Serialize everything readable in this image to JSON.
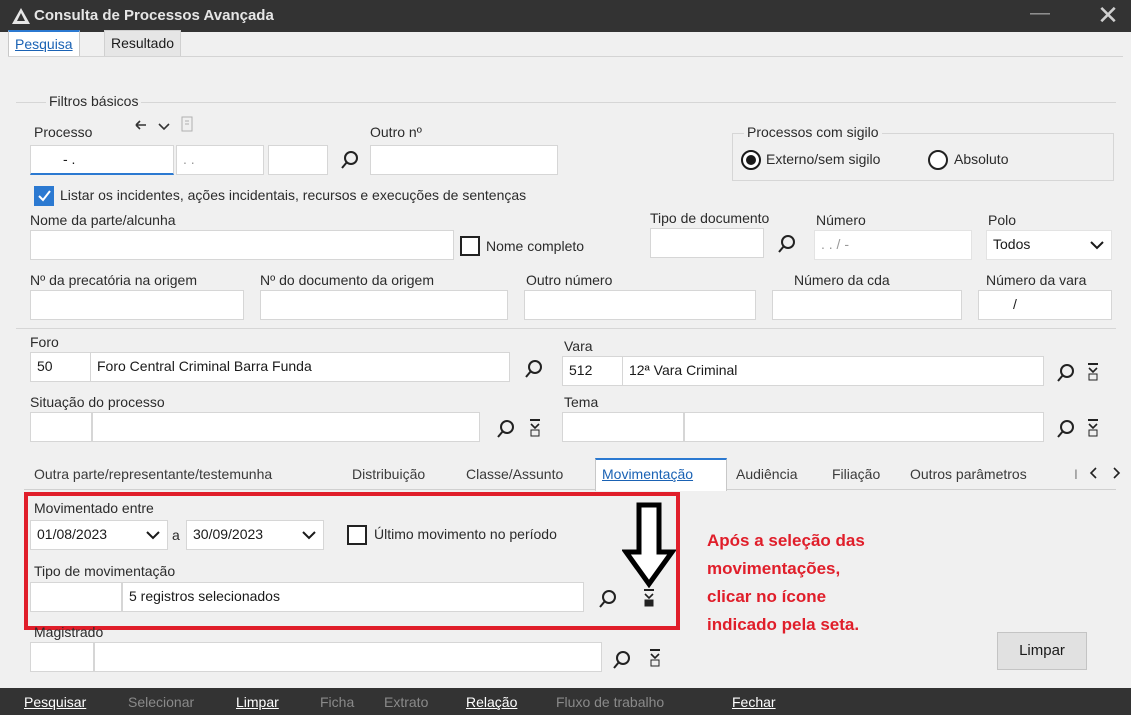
{
  "window": {
    "title": "Consulta de Processos Avançada",
    "minimize": "—",
    "close": "✕"
  },
  "tabs": [
    {
      "label": "Pesquisa"
    },
    {
      "label": "Resultado"
    }
  ],
  "filtros": {
    "group_label": "Filtros básicos",
    "processo_label": "Processo",
    "processo_value": "- .",
    "processo_part2": ". .",
    "outro_n_label": "Outro nº",
    "sigilo_label": "Processos com sigilo",
    "sigilo_options": [
      "Externo/sem sigilo",
      "Absoluto"
    ],
    "listar_incidentes": "Listar os incidentes, ações incidentais, recursos e execuções de sentenças",
    "nome_parte_label": "Nome da parte/alcunha",
    "nome_completo": "Nome completo",
    "tipo_documento_label": "Tipo de documento",
    "numero_label": "Número",
    "numero_value": ". . / -",
    "polo_label": "Polo",
    "polo_value": "Todos",
    "precatoria_label": "Nº da precatória na origem",
    "documento_origem_label": "Nº do documento da origem",
    "outro_numero_label": "Outro número",
    "numero_cda_label": "Número da cda",
    "numero_vara_label": "Número da vara",
    "numero_vara_value": "/"
  },
  "foro": {
    "label": "Foro",
    "code": "50",
    "name": "Foro Central Criminal Barra Funda"
  },
  "vara": {
    "label": "Vara",
    "code": "512",
    "name": "12ª Vara Criminal"
  },
  "situacao": {
    "label": "Situação do processo"
  },
  "tema": {
    "label": "Tema"
  },
  "subtabs": [
    {
      "label": "Outra parte/representante/testemunha"
    },
    {
      "label": "Distribuição"
    },
    {
      "label": "Classe/Assunto"
    },
    {
      "label": "Movimentação"
    },
    {
      "label": "Audiência"
    },
    {
      "label": "Filiação"
    },
    {
      "label": "Outros parâmetros"
    },
    {
      "label": "I"
    }
  ],
  "movimentacao": {
    "entre_label": "Movimentado entre",
    "date_from": "01/08/2023",
    "a_label": "a",
    "date_to": "30/09/2023",
    "ultimo_movimento": "Último movimento no período",
    "tipo_label": "Tipo de movimentação",
    "tipo_value": "5 registros selecionados"
  },
  "magistrado": {
    "label": "Magistrado"
  },
  "annotation": {
    "lines": [
      "Após a seleção das",
      "movimentações,",
      "clicar no ícone",
      "indicado pela seta."
    ]
  },
  "buttons": {
    "limpar": "Limpar"
  },
  "bottom_menu": [
    {
      "label": "Pesquisar",
      "enabled": true
    },
    {
      "label": "Selecionar",
      "enabled": false
    },
    {
      "label": "Limpar",
      "enabled": true
    },
    {
      "label": "Ficha",
      "enabled": false
    },
    {
      "label": "Extrato",
      "enabled": false
    },
    {
      "label": "Relação",
      "enabled": true
    },
    {
      "label": "Fluxo de trabalho",
      "enabled": false
    },
    {
      "label": "Fechar",
      "enabled": true
    }
  ],
  "colors": {
    "accent": "#2b79d1",
    "annotation": "#e01e2a",
    "titlebar": "#333333"
  }
}
